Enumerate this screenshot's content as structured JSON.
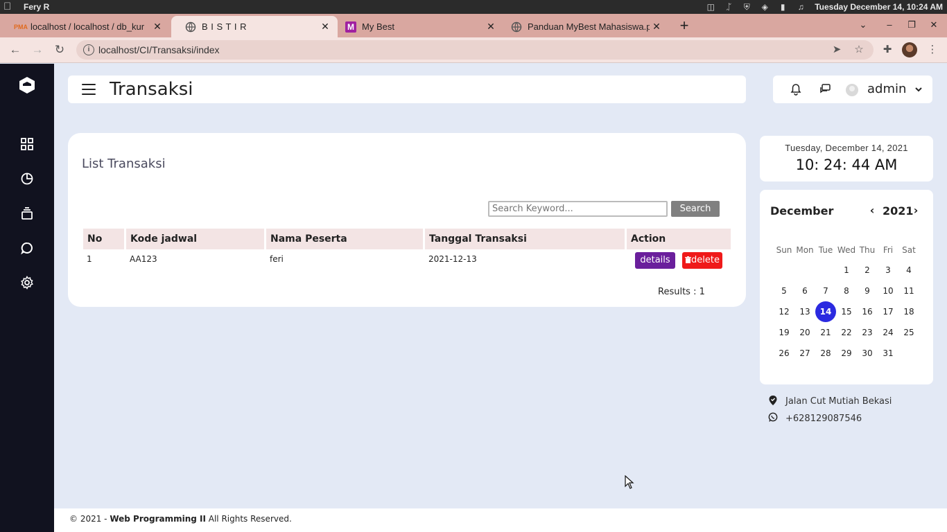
{
  "os": {
    "user": "Fery R",
    "clock": "Tuesday December 14, 10:24 AM"
  },
  "browser": {
    "tabs": [
      {
        "title": "localhost / localhost / db_kur",
        "icon": "phpmyadmin-icon"
      },
      {
        "title": "B I S T I R",
        "icon": "globe-icon"
      },
      {
        "title": "My Best",
        "icon": "mybest-icon"
      },
      {
        "title": "Panduan MyBest Mahasiswa.p",
        "icon": "globe-icon"
      }
    ],
    "url": "localhost/CI/Transaksi/index"
  },
  "header": {
    "page_title": "Transaksi",
    "username": "admin"
  },
  "main": {
    "list_title": "List Transaksi",
    "search_placeholder": "Search Keyword...",
    "search_label": "Search",
    "columns": [
      "No",
      "Kode jadwal",
      "Nama Peserta",
      "Tanggal Transaksi",
      "Action"
    ],
    "rows": [
      {
        "no": "1",
        "kode": "AA123",
        "nama": "feri",
        "tanggal": "2021-12-13"
      }
    ],
    "details_label": "details",
    "delete_label": "delete",
    "results": "Results : 1"
  },
  "widgets": {
    "date": "Tuesday, December 14, 2021",
    "time": "10: 24: 44 AM",
    "calendar": {
      "month": "December",
      "year": "2021",
      "weekdays": [
        "Sun",
        "Mon",
        "Tue",
        "Wed",
        "Thu",
        "Fri",
        "Sat"
      ],
      "first_weekday_index": 3,
      "days_in_month": 31,
      "today": 14,
      "today_color": "#2b2ae0"
    },
    "address": "Jalan Cut Mutiah Bekasi",
    "phone": "+628129087546"
  },
  "footer": {
    "prefix": "© 2021 - ",
    "brand": "Web Programming II",
    "suffix": " All Rights Reserved."
  },
  "colors": {
    "sidebar": "#11121f",
    "details_button": "#6a1f9c",
    "delete_button": "#ef1a1a",
    "page_background": "#e3e9f5"
  }
}
